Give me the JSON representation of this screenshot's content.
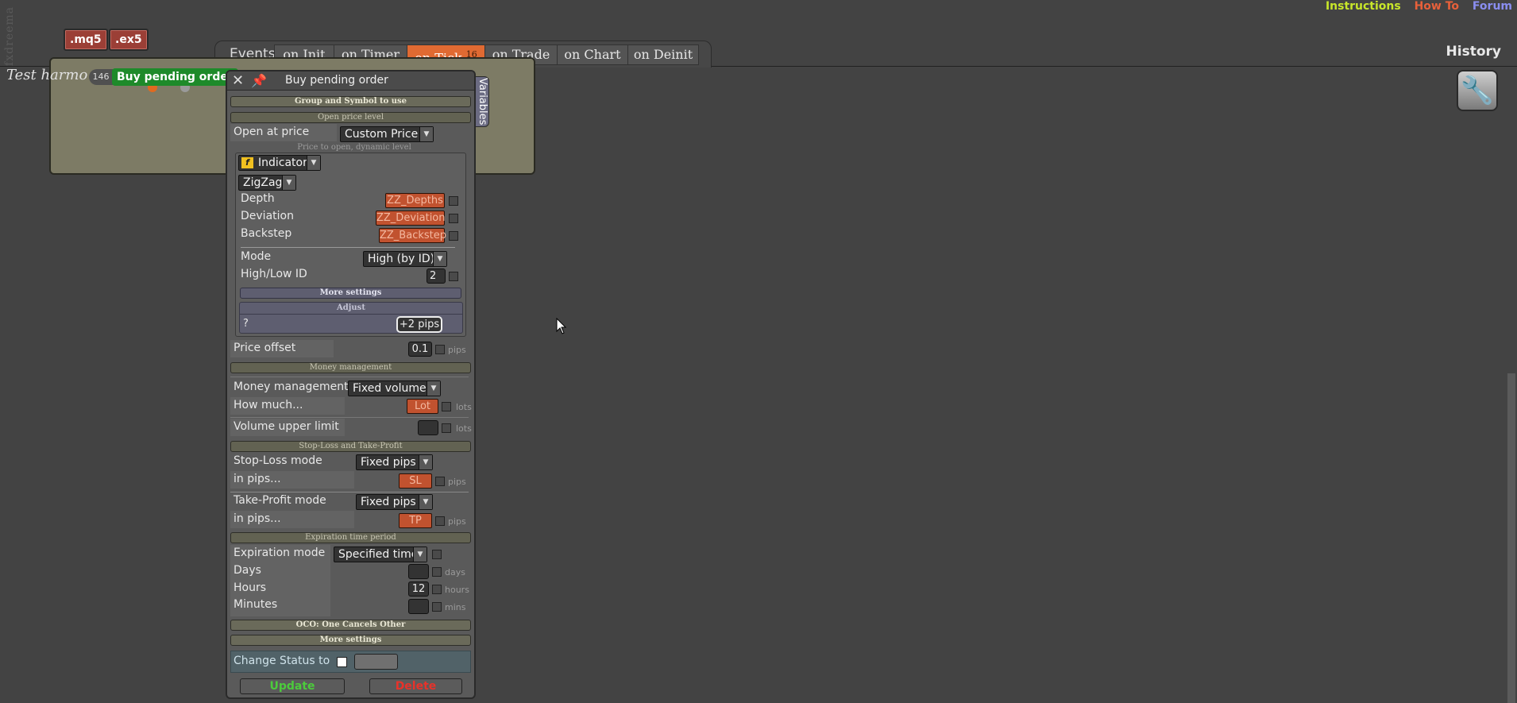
{
  "brand": "fxdreema",
  "file_buttons": [
    ".mq5",
    ".ex5"
  ],
  "top_links": {
    "instructions": "Instructions",
    "how_to": "How To",
    "forum": "Forum"
  },
  "history_label": "History",
  "events": {
    "label": "Events",
    "tabs": [
      "on Init",
      "on Timer",
      "on Tick",
      "on Trade",
      "on Chart",
      "on Deinit"
    ],
    "active_tab": "on Tick",
    "on_tick_count": "16"
  },
  "project": {
    "title": "Test harmo",
    "block_number": "146",
    "block_label": "Buy pending order"
  },
  "panel": {
    "title": "Buy pending order",
    "variables_tab": "Variables",
    "sections": {
      "group_symbol": "Group and Symbol to use",
      "open_price_level": "Open price level",
      "money_management": "Money management",
      "sl_tp": "Stop-Loss and Take-Profit",
      "expiration": "Expiration time period",
      "oco": "OCO: One Cancels Other",
      "more_settings": "More settings"
    },
    "open_at_price": {
      "label": "Open at price",
      "value": "Custom Price"
    },
    "price_to_open_hint": "Price to open, dynamic level",
    "indicator": {
      "type_icon": "f",
      "type": "Indicator",
      "name": "ZigZag",
      "depth": {
        "label": "Depth",
        "value": "ZZ_Depths"
      },
      "deviation": {
        "label": "Deviation",
        "value": "ZZ_Deviation"
      },
      "backstep": {
        "label": "Backstep",
        "value": "ZZ_Backstep"
      },
      "mode": {
        "label": "Mode",
        "value": "High (by ID)"
      },
      "high_low_id": {
        "label": "High/Low ID",
        "value": "2"
      },
      "more_settings": "More settings",
      "adjust": {
        "title": "Adjust",
        "label": "?",
        "value": "+2 pips"
      }
    },
    "price_offset": {
      "label": "Price offset",
      "value": "0.1",
      "unit": "pips"
    },
    "money_management": {
      "label": "Money management",
      "value": "Fixed volume"
    },
    "how_much": {
      "label": "How much...",
      "value": "Lot",
      "unit": "lots"
    },
    "volume_upper_limit": {
      "label": "Volume upper limit",
      "value": "",
      "unit": "lots"
    },
    "stop_loss_mode": {
      "label": "Stop-Loss mode",
      "value": "Fixed pips"
    },
    "sl_in_pips": {
      "label": "in pips...",
      "value": "SL",
      "unit": "pips"
    },
    "take_profit_mode": {
      "label": "Take-Profit mode",
      "value": "Fixed pips"
    },
    "tp_in_pips": {
      "label": "in pips...",
      "value": "TP",
      "unit": "pips"
    },
    "expiration_mode": {
      "label": "Expiration mode",
      "value": "Specified time"
    },
    "days": {
      "label": "Days",
      "value": "",
      "unit": "days"
    },
    "hours": {
      "label": "Hours",
      "value": "12",
      "unit": "hours"
    },
    "minutes": {
      "label": "Minutes",
      "value": "",
      "unit": "mins"
    },
    "change_status": {
      "label": "Change Status to",
      "value": ""
    },
    "update_button": "Update",
    "delete_button": "Delete"
  },
  "colors": {
    "instructions": "#c8e62a",
    "how_to": "#e8603a",
    "forum": "#8a8ef0",
    "active_tab": "#e06a32",
    "block_chip": "#1e8a2a",
    "variable_field": "#c1522f",
    "update": "#4ccb3c",
    "delete": "#e8322a"
  }
}
